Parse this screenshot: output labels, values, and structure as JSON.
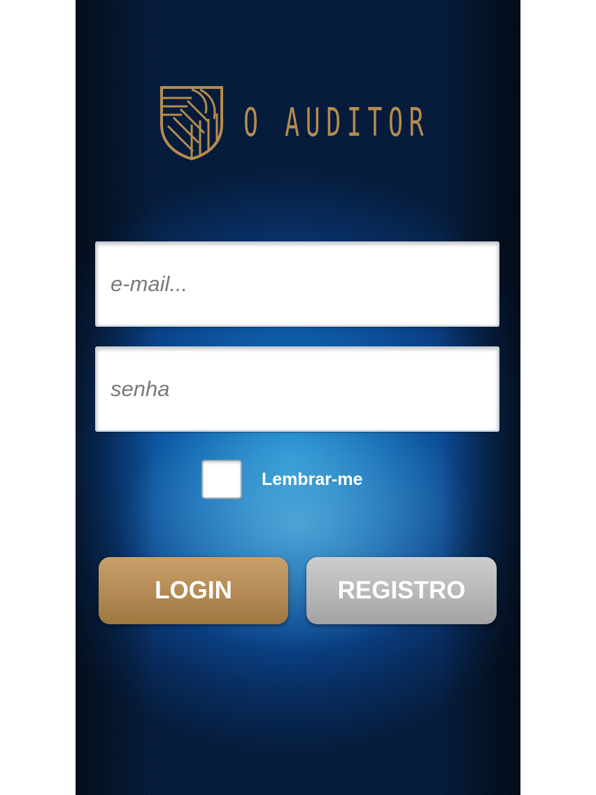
{
  "brand": {
    "name": "O AUDITOR",
    "logo_icon": "shield-logo-icon",
    "color": "#b58c4e"
  },
  "form": {
    "email_placeholder": "e-mail...",
    "email_value": "",
    "password_placeholder": "senha",
    "password_value": "",
    "remember_label": "Lembrar-me",
    "remember_checked": false
  },
  "buttons": {
    "login_label": "LOGIN",
    "register_label": "REGISTRO"
  },
  "colors": {
    "accent_gold": "#b58c4e",
    "button_gray": "#b7b7b7",
    "background_blue": "#0d62ad"
  }
}
